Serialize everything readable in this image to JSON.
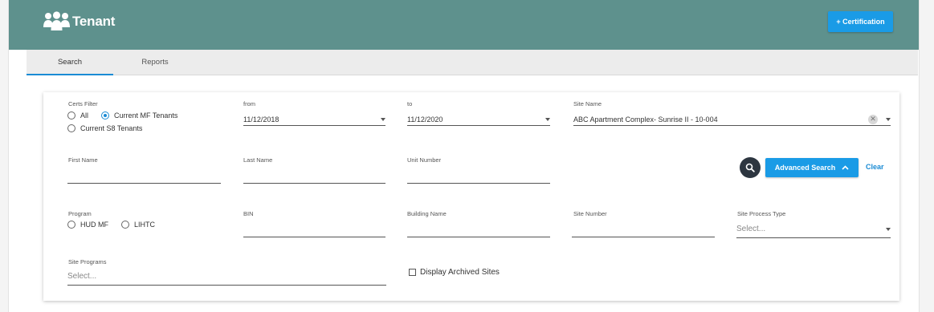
{
  "app": {
    "title": "Tenant",
    "certification_button": "+ Certification"
  },
  "tabs": [
    {
      "label": "Search",
      "active": true
    },
    {
      "label": "Reports",
      "active": false
    }
  ],
  "filters": {
    "certs_filter": {
      "label": "Certs Filter",
      "options": [
        "All",
        "Current MF Tenants",
        "Current S8 Tenants"
      ],
      "selected": "Current MF Tenants"
    },
    "from": {
      "label": "from",
      "value": "11/12/2018"
    },
    "to": {
      "label": "to",
      "value": "11/12/2020"
    },
    "site_name": {
      "label": "Site Name",
      "value": "ABC Apartment Complex- Sunrise II - 10-004"
    },
    "first_name": {
      "label": "First Name",
      "value": ""
    },
    "last_name": {
      "label": "Last Name",
      "value": ""
    },
    "unit_number": {
      "label": "Unit Number",
      "value": ""
    },
    "program": {
      "label": "Program",
      "options": [
        "HUD MF",
        "LIHTC"
      ]
    },
    "bin": {
      "label": "BIN",
      "value": ""
    },
    "building_name": {
      "label": "Building Name",
      "value": ""
    },
    "site_number": {
      "label": "Site Number",
      "value": ""
    },
    "site_process_type": {
      "label": "Site Process Type",
      "placeholder": "Select..."
    },
    "site_programs": {
      "label": "Site Programs",
      "placeholder": "Select..."
    },
    "display_archived": {
      "label": "Display Archived Sites",
      "checked": false
    }
  },
  "actions": {
    "advanced_search": "Advanced Search",
    "clear": "Clear"
  },
  "colors": {
    "header": "#5e918d",
    "primary": "#1a9be6",
    "link": "#1a8bd4",
    "search_circle": "#2d3640"
  }
}
